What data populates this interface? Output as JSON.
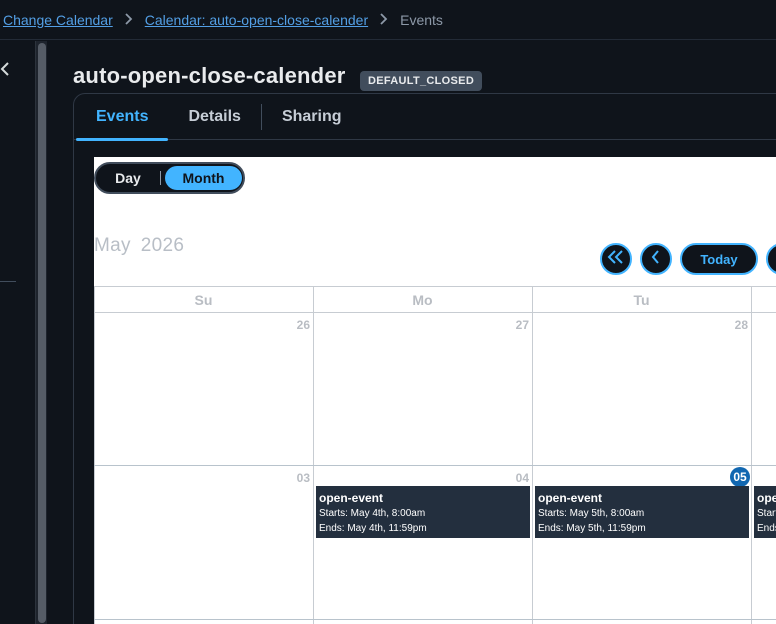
{
  "breadcrumb": {
    "items": [
      "Change Calendar",
      "Calendar: auto-open-close-calender"
    ],
    "current": "Events"
  },
  "header": {
    "title": "auto-open-close-calender",
    "badge": "DEFAULT_CLOSED"
  },
  "tabs": [
    "Events",
    "Details",
    "Sharing"
  ],
  "calendar": {
    "view_toggle": {
      "day": "Day",
      "month": "Month",
      "selected": "Month"
    },
    "month": "May",
    "year": "2026",
    "today_label": "Today",
    "days_of_week": [
      "Su",
      "Mo",
      "Tu"
    ],
    "week1": [
      "26",
      "27",
      "28"
    ],
    "week2": [
      "03",
      "04",
      "05"
    ],
    "today_date": "05",
    "events": [
      {
        "title": "open-event",
        "starts": "Starts: May 4th, 8:00am",
        "ends": "Ends: May 4th, 11:59pm"
      },
      {
        "title": "open-event",
        "starts": "Starts: May 5th, 8:00am",
        "ends": "Ends: May 5th, 11:59pm"
      },
      {
        "title": "ope",
        "starts": "Start",
        "ends": "Ends"
      }
    ]
  },
  "colors": {
    "background": "#0f141b",
    "accent": "#42b4ff",
    "event_bg": "#232f3e",
    "today_circle": "#1167b1"
  }
}
